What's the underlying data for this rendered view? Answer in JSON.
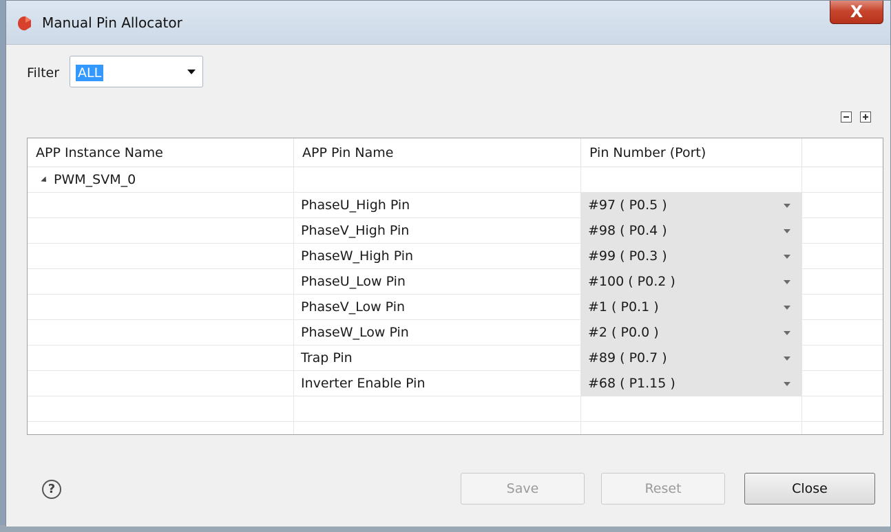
{
  "window": {
    "title": "Manual Pin Allocator",
    "close_glyph": "X"
  },
  "filter": {
    "label": "Filter",
    "value": "ALL"
  },
  "toolbar": {
    "collapse_icon": "collapse-all-icon",
    "expand_icon": "expand-all-icon"
  },
  "table": {
    "columns": [
      "APP Instance Name",
      "APP Pin Name",
      "Pin Number (Port)"
    ],
    "instance": "PWM_SVM_0",
    "rows": [
      {
        "pin_name": "PhaseU_High Pin",
        "pin_number": "#97 ( P0.5 )"
      },
      {
        "pin_name": "PhaseV_High Pin",
        "pin_number": "#98 ( P0.4 )"
      },
      {
        "pin_name": "PhaseW_High Pin",
        "pin_number": "#99 ( P0.3 )"
      },
      {
        "pin_name": "PhaseU_Low Pin",
        "pin_number": "#100 ( P0.2 )"
      },
      {
        "pin_name": "PhaseV_Low Pin",
        "pin_number": "#1 ( P0.1 )"
      },
      {
        "pin_name": "PhaseW_Low Pin",
        "pin_number": "#2 ( P0.0 )"
      },
      {
        "pin_name": "Trap Pin",
        "pin_number": "#89 ( P0.7 )"
      },
      {
        "pin_name": "Inverter Enable Pin",
        "pin_number": "#68 ( P1.15 )"
      }
    ]
  },
  "footer": {
    "help_glyph": "?",
    "save_label": "Save",
    "reset_label": "Reset",
    "close_label": "Close"
  },
  "colors": {
    "selection": "#3399ff",
    "close_button": "#c7452d",
    "pin_cell_bg": "#e4e4e4"
  }
}
